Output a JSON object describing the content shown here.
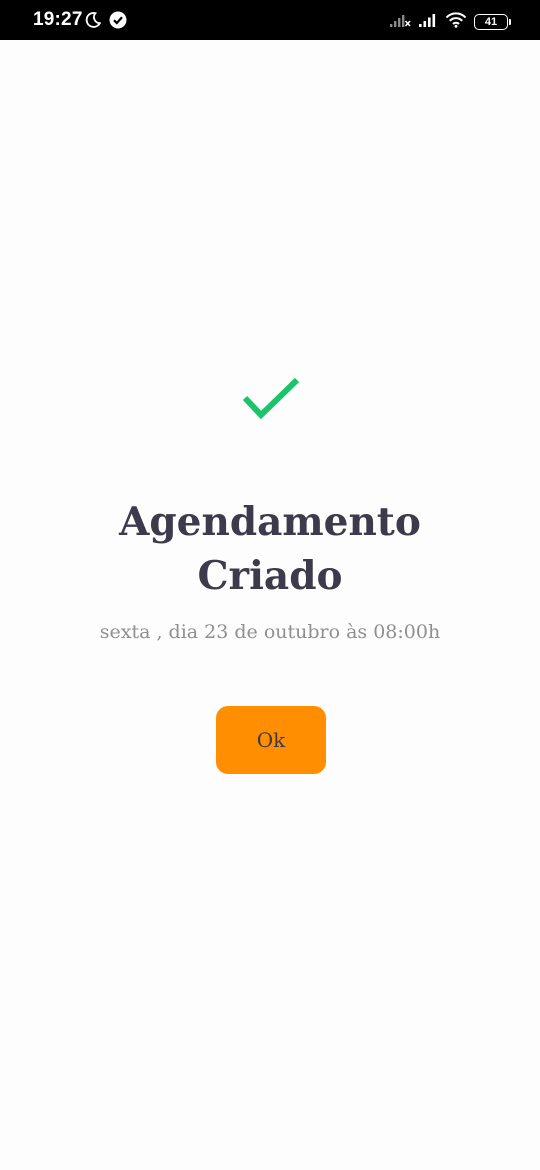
{
  "status_bar": {
    "time": "19:27",
    "battery_level": "41",
    "left_icons": [
      "moon-icon",
      "check-circle-icon"
    ],
    "right_icons": [
      "signal-x-icon",
      "signal-icon",
      "wifi-icon",
      "battery-icon"
    ]
  },
  "confirmation": {
    "icon": "checkmark-icon",
    "icon_color": "#1bc36a",
    "title_line1": "Agendamento",
    "title_line2": "Criado",
    "subtitle": "sexta , dia 23 de outubro às 08:00h",
    "ok_label": "Ok",
    "button_color": "#ff8f00"
  }
}
